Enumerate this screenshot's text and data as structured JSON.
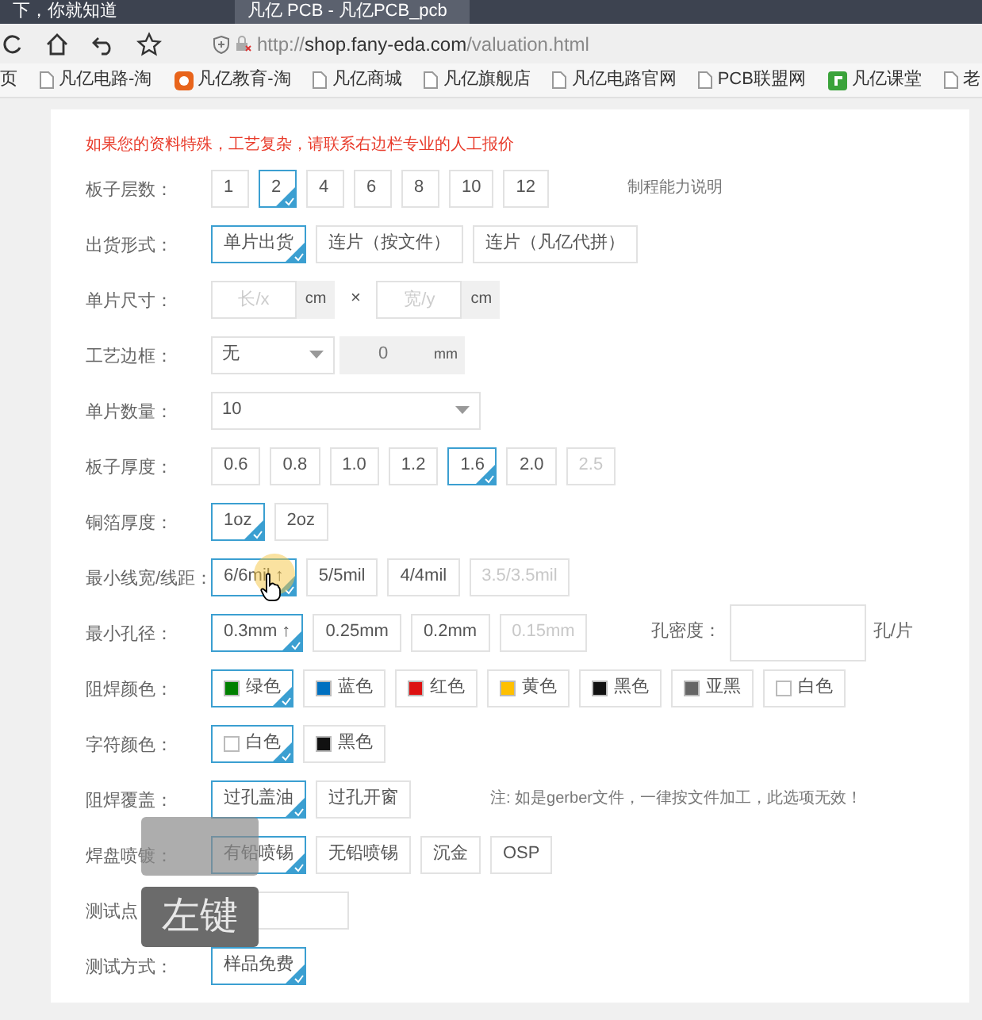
{
  "browser": {
    "tabs": [
      {
        "title": "下，你就知道",
        "selected": false
      },
      {
        "title": "凡亿 PCB - 凡亿PCB_pcb",
        "selected": true
      }
    ],
    "url_scheme": "http://",
    "url_host": "shop.fany-eda.com",
    "url_path": "/valuation.html",
    "bookmarks": [
      {
        "label": "页",
        "kind": "cut"
      },
      {
        "label": "凡亿电路-淘",
        "kind": "page"
      },
      {
        "label": "凡亿教育-淘",
        "kind": "edu"
      },
      {
        "label": "凡亿商城",
        "kind": "page"
      },
      {
        "label": "凡亿旗舰店",
        "kind": "page"
      },
      {
        "label": "凡亿电路官网",
        "kind": "page"
      },
      {
        "label": "PCB联盟网",
        "kind": "page"
      },
      {
        "label": "凡亿课堂",
        "kind": "course"
      },
      {
        "label": "老",
        "kind": "page"
      }
    ]
  },
  "form": {
    "notice": "如果您的资料特殊，工艺复杂，请联系右边栏专业的人工报价",
    "rows": [
      {
        "kind": "options",
        "label": "板子层数：",
        "options": [
          {
            "text": "1",
            "selected": false,
            "disabled": false
          },
          {
            "text": "2",
            "selected": true,
            "disabled": false
          },
          {
            "text": "4",
            "selected": false,
            "disabled": false
          },
          {
            "text": "6",
            "selected": false,
            "disabled": false
          },
          {
            "text": "8",
            "selected": false,
            "disabled": false
          },
          {
            "text": "10",
            "selected": false,
            "disabled": false
          },
          {
            "text": "12",
            "selected": false,
            "disabled": false
          }
        ],
        "note": "制程能力说明"
      },
      {
        "kind": "options",
        "label": "出货形式：",
        "options": [
          {
            "text": "单片出货",
            "selected": true,
            "disabled": false
          },
          {
            "text": "连片（按文件）",
            "selected": false,
            "disabled": false
          },
          {
            "text": "连片（凡亿代拼）",
            "selected": false,
            "disabled": false
          }
        ]
      },
      {
        "kind": "size",
        "label": "单片尺寸：",
        "x_placeholder": "长/x",
        "x_unit": "cm",
        "times": "×",
        "y_placeholder": "宽/y",
        "y_unit": "cm"
      },
      {
        "kind": "select_input",
        "label": "工艺边框：",
        "value": "无",
        "input_value": "0",
        "unit": "mm"
      },
      {
        "kind": "select",
        "label": "单片数量：",
        "value": "10"
      },
      {
        "kind": "options",
        "label": "板子厚度：",
        "options": [
          {
            "text": "0.6",
            "selected": false,
            "disabled": false
          },
          {
            "text": "0.8",
            "selected": false,
            "disabled": false
          },
          {
            "text": "1.0",
            "selected": false,
            "disabled": false
          },
          {
            "text": "1.2",
            "selected": false,
            "disabled": false
          },
          {
            "text": "1.6",
            "selected": true,
            "disabled": false
          },
          {
            "text": "2.0",
            "selected": false,
            "disabled": false
          },
          {
            "text": "2.5",
            "selected": false,
            "disabled": true
          }
        ]
      },
      {
        "kind": "options",
        "label": "铜箔厚度：",
        "options": [
          {
            "text": "1oz",
            "selected": true,
            "disabled": false
          },
          {
            "text": "2oz",
            "selected": false,
            "disabled": false
          }
        ]
      },
      {
        "kind": "options",
        "label": "最小线宽/线距：",
        "options": [
          {
            "text": "6/6mil ↑",
            "selected": true,
            "disabled": false,
            "pointer": true
          },
          {
            "text": "5/5mil",
            "selected": false,
            "disabled": false
          },
          {
            "text": "4/4mil",
            "selected": false,
            "disabled": false
          },
          {
            "text": "3.5/3.5mil",
            "selected": false,
            "disabled": true
          }
        ]
      },
      {
        "kind": "options",
        "label": "最小孔径：",
        "options": [
          {
            "text": "0.3mm ↑",
            "selected": true,
            "disabled": false
          },
          {
            "text": "0.25mm",
            "selected": false,
            "disabled": false
          },
          {
            "text": "0.2mm",
            "selected": false,
            "disabled": false
          },
          {
            "text": "0.15mm",
            "selected": false,
            "disabled": true
          }
        ],
        "extra_label": "孔密度：",
        "extra_unit": "孔/片"
      },
      {
        "kind": "options",
        "label": "阻焊颜色：",
        "options": [
          {
            "text": "绿色",
            "selected": true,
            "disabled": false,
            "color": "#008000"
          },
          {
            "text": "蓝色",
            "selected": false,
            "disabled": false,
            "color": "#0070c0"
          },
          {
            "text": "红色",
            "selected": false,
            "disabled": false,
            "color": "#dd1111"
          },
          {
            "text": "黄色",
            "selected": false,
            "disabled": false,
            "color": "#ffc000"
          },
          {
            "text": "黑色",
            "selected": false,
            "disabled": false,
            "color": "#111111"
          },
          {
            "text": "亚黑",
            "selected": false,
            "disabled": false,
            "color": "#666666"
          },
          {
            "text": "白色",
            "selected": false,
            "disabled": false,
            "color": "#ffffff"
          }
        ]
      },
      {
        "kind": "options",
        "label": "字符颜色：",
        "options": [
          {
            "text": "白色",
            "selected": true,
            "disabled": false,
            "color": "#ffffff"
          },
          {
            "text": "黑色",
            "selected": false,
            "disabled": false,
            "color": "#111111"
          }
        ]
      },
      {
        "kind": "options",
        "label": "阻焊覆盖：",
        "options": [
          {
            "text": "过孔盖油",
            "selected": true,
            "disabled": false
          },
          {
            "text": "过孔开窗",
            "selected": false,
            "disabled": false
          }
        ],
        "note": "注: 如是gerber文件，一律按文件加工，此选项无效！"
      },
      {
        "kind": "options",
        "label": "焊盘喷镀：",
        "options": [
          {
            "text": "有铅喷锡",
            "selected": true,
            "disabled": false
          },
          {
            "text": "无铅喷锡",
            "selected": false,
            "disabled": false
          },
          {
            "text": "沉金",
            "selected": false,
            "disabled": false
          },
          {
            "text": "OSP",
            "selected": false,
            "disabled": false
          }
        ]
      },
      {
        "kind": "input",
        "label": "测试点"
      },
      {
        "kind": "options",
        "label": "测试方式：",
        "options": [
          {
            "text": "样品免费",
            "selected": true,
            "disabled": false
          }
        ]
      }
    ]
  },
  "key_overlay": {
    "text": "左键"
  }
}
